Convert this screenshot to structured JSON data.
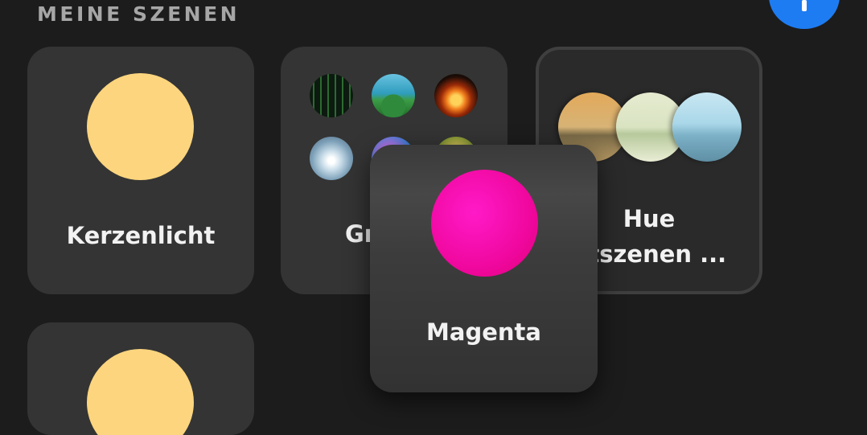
{
  "section": {
    "title": "MEINE SZENEN"
  },
  "scenes": {
    "kerzenlicht": {
      "label": "Kerzenlicht",
      "color": "#fcd57e"
    },
    "group": {
      "label_visible": "Gr",
      "thumbnails": [
        "matrix-code",
        "tropical-coast",
        "campfire",
        "sky-clouds",
        "nebula",
        "plant"
      ]
    },
    "hue": {
      "label_line1": "Hue",
      "label_line2": "ntszenen ..."
    },
    "magenta": {
      "label": "Magenta",
      "color": "#f0089f"
    },
    "bottom": {
      "color": "#fcd57e"
    }
  },
  "colors": {
    "background": "#1c1c1c",
    "card": "#343434",
    "accent": "#1e7cf2"
  }
}
